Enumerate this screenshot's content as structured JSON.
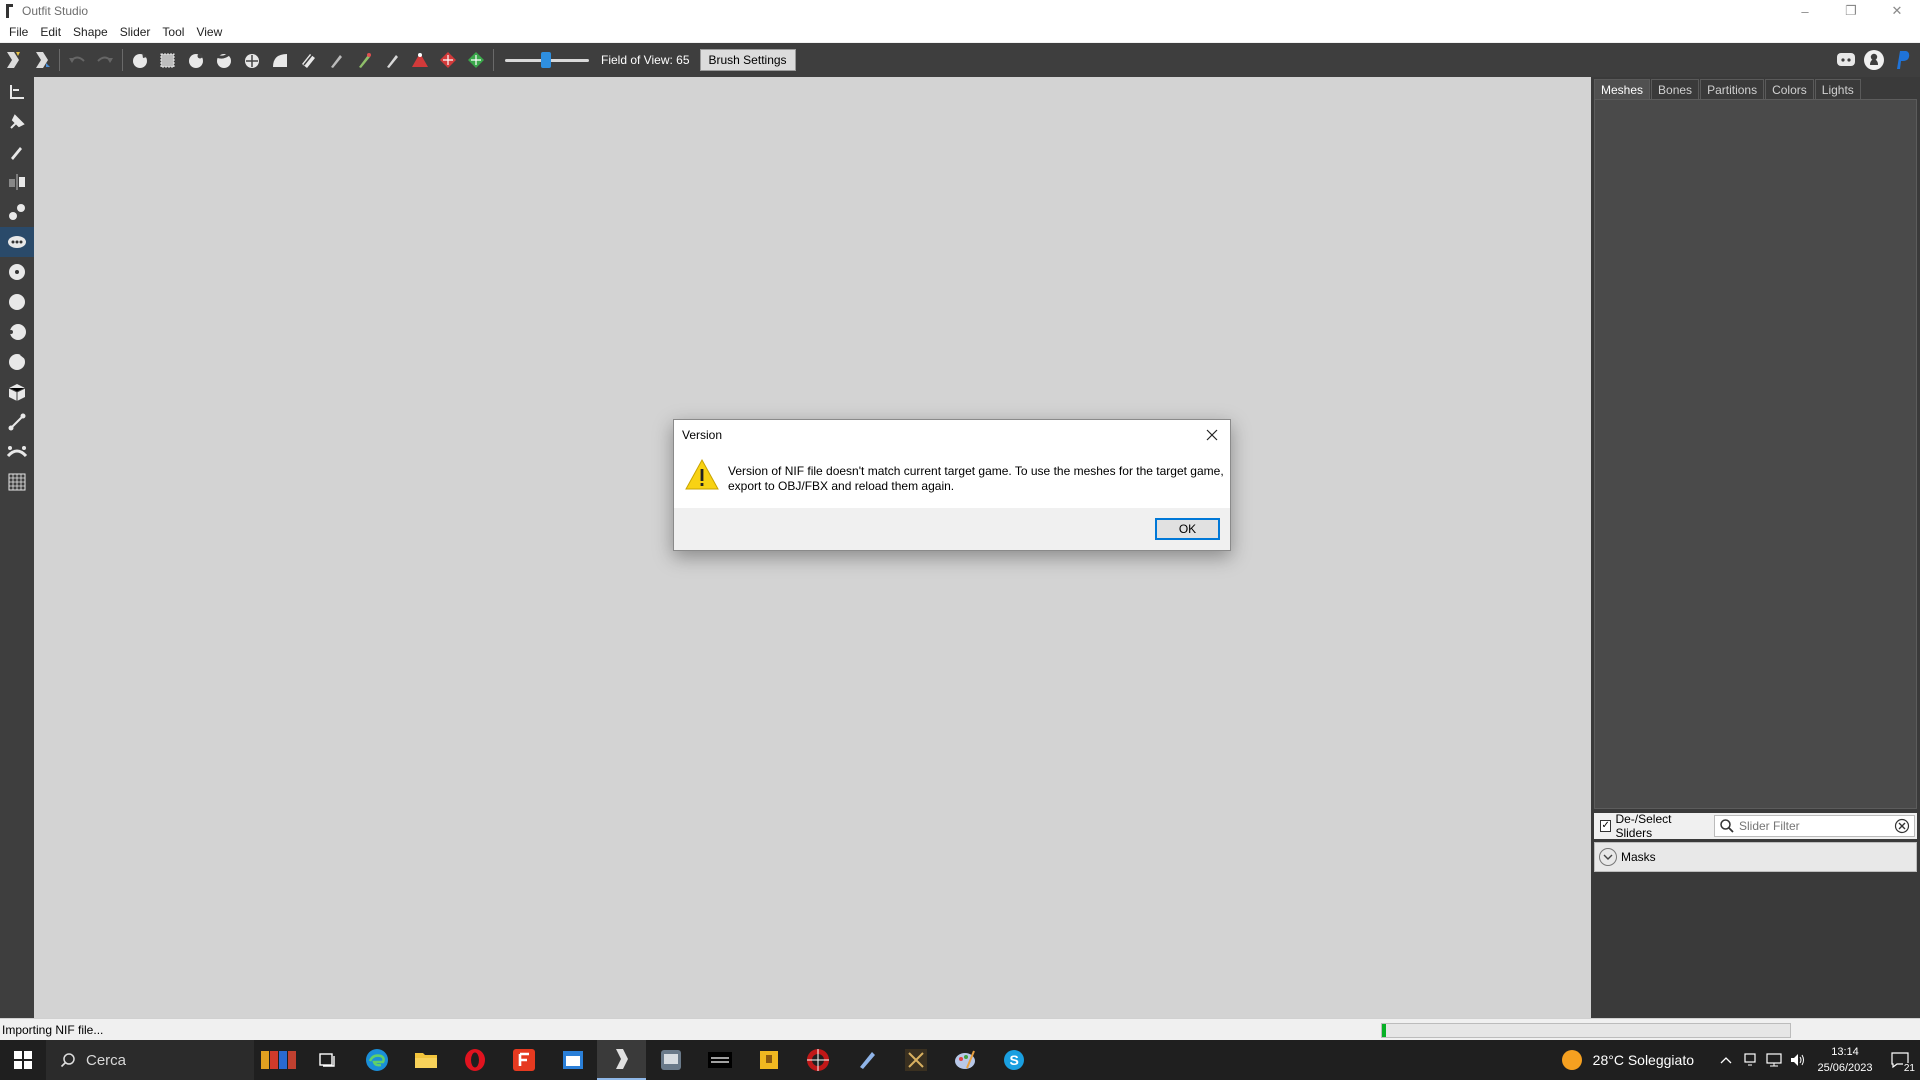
{
  "window": {
    "title": "Outfit Studio",
    "minimize": "–",
    "restore": "❐",
    "close": "✕"
  },
  "menu": [
    "File",
    "Edit",
    "Shape",
    "Slider",
    "Tool",
    "View"
  ],
  "toolbar": {
    "fov_label": "Field of View: 65",
    "fov_value": 65,
    "brush_settings": "Brush Settings"
  },
  "right_panel": {
    "tabs": [
      "Meshes",
      "Bones",
      "Partitions",
      "Colors",
      "Lights"
    ],
    "active_tab": "Meshes",
    "deselect_sliders_label": "De-/Select Sliders",
    "deselect_checked": true,
    "slider_filter_placeholder": "Slider Filter",
    "masks_label": "Masks"
  },
  "status": {
    "text": "Importing NIF file...",
    "progress": 0.01
  },
  "dialog": {
    "title": "Version",
    "message": "Version of NIF file doesn't match current target game. To use the meshes for the target game, export to OBJ/FBX and reload them again.",
    "ok": "OK"
  },
  "taskbar": {
    "search_label": "Cerca",
    "weather": "28°C  Soleggiato",
    "time": "13:14",
    "date": "25/06/2023",
    "notification_count": "21"
  },
  "colors": {
    "accent": "#0078d7",
    "progress": "#06b025",
    "toolbar_bg": "#3e3e3e",
    "viewport_bg": "#d3d3d3"
  }
}
